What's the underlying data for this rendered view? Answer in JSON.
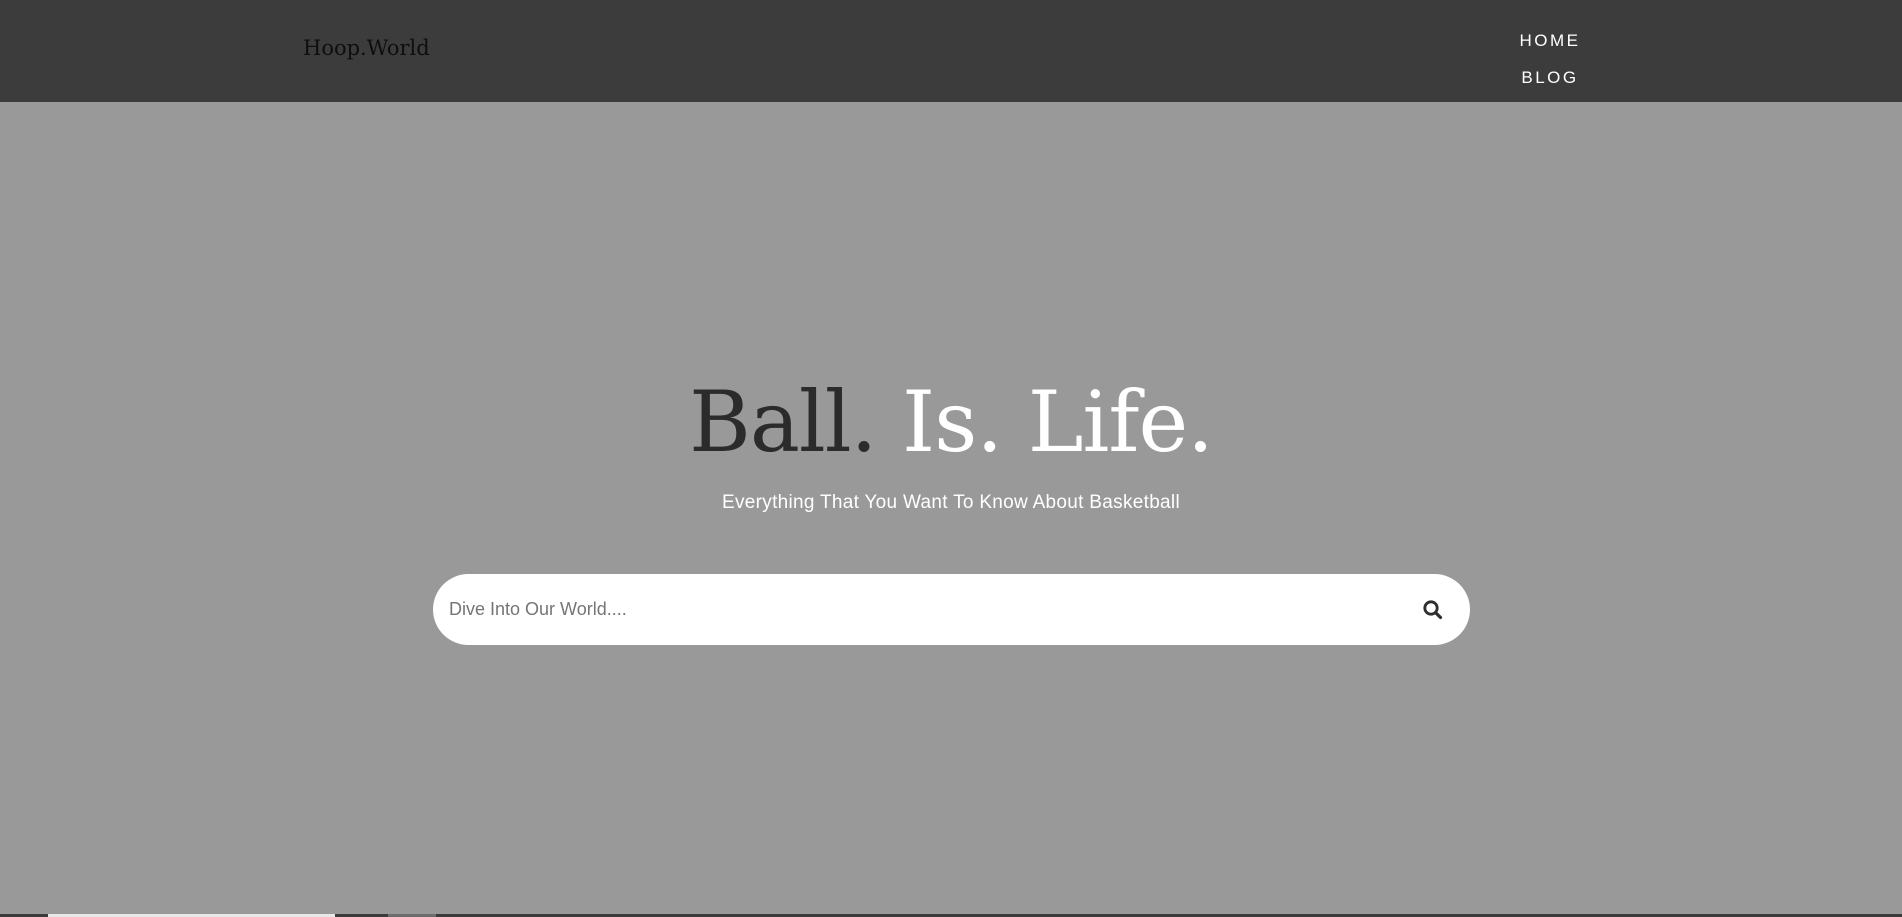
{
  "navbar": {
    "brand": "Hoop.World",
    "links": [
      {
        "label": "HOME"
      },
      {
        "label": "BLOG"
      }
    ]
  },
  "hero": {
    "title_part1": "Ball.",
    "title_part2": "Is. Life.",
    "subtitle": "Everything That You Want To Know About Basketball"
  },
  "search": {
    "placeholder": "Dive Into Our World....",
    "value": "",
    "icon": "search-icon"
  },
  "colors": {
    "navbar_bg": "#3c3c3c",
    "page_bg": "#999999",
    "title_dark": "#2b2b2b",
    "title_light": "#ffffff"
  }
}
